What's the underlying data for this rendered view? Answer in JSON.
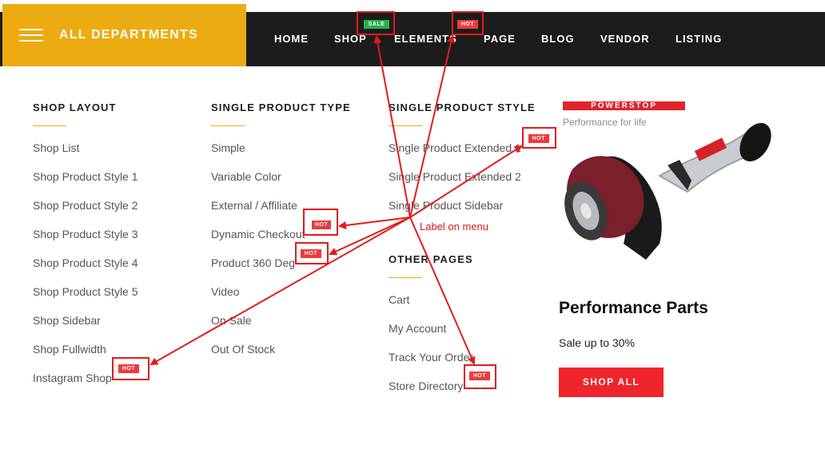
{
  "nav": {
    "departments_label": "ALL DEPARTMENTS",
    "items": [
      "HOME",
      "SHOP",
      "ELEMENTS",
      "PAGE",
      "BLOG",
      "VENDOR",
      "LISTING"
    ],
    "shop_badge": "SALE",
    "elements_badge": "HOT"
  },
  "menu": {
    "columns": [
      {
        "title": "SHOP LAYOUT",
        "items": [
          "Shop List",
          "Shop Product Style 1",
          "Shop Product Style 2",
          "Shop Product Style 3",
          "Shop Product Style 4",
          "Shop Product Style 5",
          "Shop Sidebar",
          "Shop Fullwidth",
          "Instagram Shop"
        ]
      },
      {
        "title": "SINGLE PRODUCT TYPE",
        "items": [
          "Simple",
          "Variable Color",
          "External / Affiliate",
          "Dynamic Checkout",
          "Product 360 Deg",
          "Video",
          "On Sale",
          "Out Of Stock"
        ]
      },
      {
        "title": "SINGLE PRODUCT STYLE",
        "items": [
          "Single Product Extended 1",
          "Single Product Extended 2",
          "Single Product Sidebar"
        ]
      },
      {
        "title": "OTHER PAGES",
        "items": [
          "Cart",
          "My Account",
          "Track Your Order",
          "Store Directory"
        ]
      }
    ],
    "hot_label": "HOT"
  },
  "promo": {
    "brand": "POWERSTOP",
    "tagline": "Performance for life",
    "title": "Performance Parts",
    "subtitle": "Sale up to 30%",
    "button": "SHOP ALL"
  },
  "annotation": {
    "label": "Label on menu",
    "color": "#e21b1b"
  },
  "colors": {
    "accent": "#ecab10",
    "nav_bg": "#1c1c1c",
    "hot": "#ed3b3b",
    "sale": "#27b24a",
    "button": "#f0252b"
  }
}
